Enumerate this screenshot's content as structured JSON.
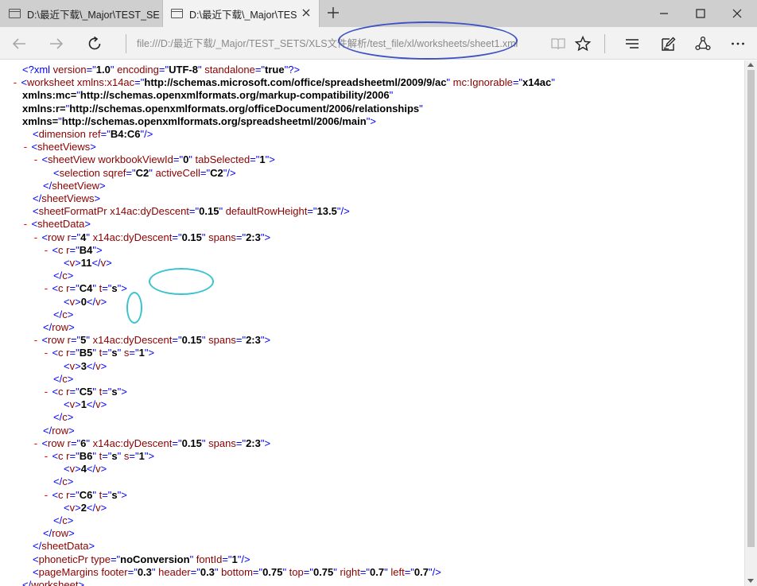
{
  "browser": {
    "tabs": [
      {
        "title": "D:\\最近下载\\_Major\\TEST_SE",
        "active": false
      },
      {
        "title": "D:\\最近下载\\_Major\\TES",
        "active": true
      }
    ],
    "address": "file:///D:/最近下载/_Major/TEST_SETS/XLS文件解析/test_file/xl/worksheets/sheet1.xml",
    "colors": {
      "annotation_blue": "#3f52c4",
      "annotation_cyan": "#39c3cf",
      "xml_expando": "#ff0000",
      "xml_tag": "#8b0000",
      "xml_markup": "#000080"
    }
  },
  "xml": {
    "lines": [
      {
        "t": "  <?xml version=\"1.0\" encoding=\"UTF-8\" standalone=\"true\"?>"
      },
      {
        "t": "- <worksheet xmlns:x14ac=\"http://schemas.microsoft.com/office/spreadsheetml/2009/9/ac\" mc:Ignorable=\"x14ac\""
      },
      {
        "t": "  xmlns:mc=\"http://schemas.openxmlformats.org/markup-compatibility/2006\""
      },
      {
        "t": "  xmlns:r=\"http://schemas.openxmlformats.org/officeDocument/2006/relationships\""
      },
      {
        "t": "  xmlns=\"http://schemas.openxmlformats.org/spreadsheetml/2006/main\">"
      },
      {
        "t": "    <dimension ref=\"B4:C6\"/>"
      },
      {
        "t": "  - <sheetViews>"
      },
      {
        "t": "    - <sheetView workbookViewId=\"0\" tabSelected=\"1\">"
      },
      {
        "t": "        <selection sqref=\"C2\" activeCell=\"C2\"/>"
      },
      {
        "t": "      </sheetView>"
      },
      {
        "t": "    </sheetViews>"
      },
      {
        "t": "    <sheetFormatPr x14ac:dyDescent=\"0.15\" defaultRowHeight=\"13.5\"/>"
      },
      {
        "t": "  - <sheetData>"
      },
      {
        "t": "    - <row r=\"4\" x14ac:dyDescent=\"0.15\" spans=\"2:3\">"
      },
      {
        "t": "      - <c r=\"B4\">"
      },
      {
        "t": "          <v>11</v>"
      },
      {
        "t": "        </c>"
      },
      {
        "t": "      - <c r=\"C4\" t=\"s\">"
      },
      {
        "t": "          <v>0</v>"
      },
      {
        "t": "        </c>"
      },
      {
        "t": "      </row>"
      },
      {
        "t": "    - <row r=\"5\" x14ac:dyDescent=\"0.15\" spans=\"2:3\">"
      },
      {
        "t": "      - <c r=\"B5\" t=\"s\" s=\"1\">"
      },
      {
        "t": "          <v>3</v>"
      },
      {
        "t": "        </c>"
      },
      {
        "t": "      - <c r=\"C5\" t=\"s\">"
      },
      {
        "t": "          <v>1</v>"
      },
      {
        "t": "        </c>"
      },
      {
        "t": "      </row>"
      },
      {
        "t": "    - <row r=\"6\" x14ac:dyDescent=\"0.15\" spans=\"2:3\">"
      },
      {
        "t": "      - <c r=\"B6\" t=\"s\" s=\"1\">"
      },
      {
        "t": "          <v>4</v>"
      },
      {
        "t": "        </c>"
      },
      {
        "t": "      - <c r=\"C6\" t=\"s\">"
      },
      {
        "t": "          <v>2</v>"
      },
      {
        "t": "        </c>"
      },
      {
        "t": "      </row>"
      },
      {
        "t": "    </sheetData>"
      },
      {
        "t": "    <phoneticPr type=\"noConversion\" fontId=\"1\"/>"
      },
      {
        "t": "    <pageMargins footer=\"0.3\" header=\"0.3\" bottom=\"0.75\" top=\"0.75\" right=\"0.7\" left=\"0.7\"/>"
      },
      {
        "t": "  </worksheet>"
      }
    ]
  }
}
